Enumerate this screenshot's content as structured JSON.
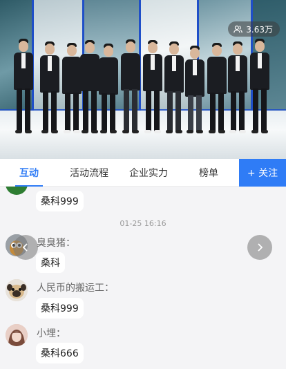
{
  "header": {
    "viewer_count": "3.63万",
    "viewer_icon": "people-icon"
  },
  "tabs": [
    {
      "label": "互动",
      "active": true
    },
    {
      "label": "活动流程",
      "active": false
    },
    {
      "label": "企业实力",
      "active": false
    },
    {
      "label": "榜单",
      "active": false
    }
  ],
  "follow_button": {
    "label": "+ 关注"
  },
  "chat": {
    "top_partial": {
      "message": "桑科999"
    },
    "timestamp": "01-25 16:16",
    "messages": [
      {
        "name": "臭臭猪：",
        "message": "桑科"
      },
      {
        "name": "人民币的搬运工：",
        "message": "桑科999"
      },
      {
        "name": "小埋：",
        "message": "桑科666"
      }
    ]
  },
  "colors": {
    "accent": "#2f7cf6",
    "background": "#f4f4f6"
  }
}
